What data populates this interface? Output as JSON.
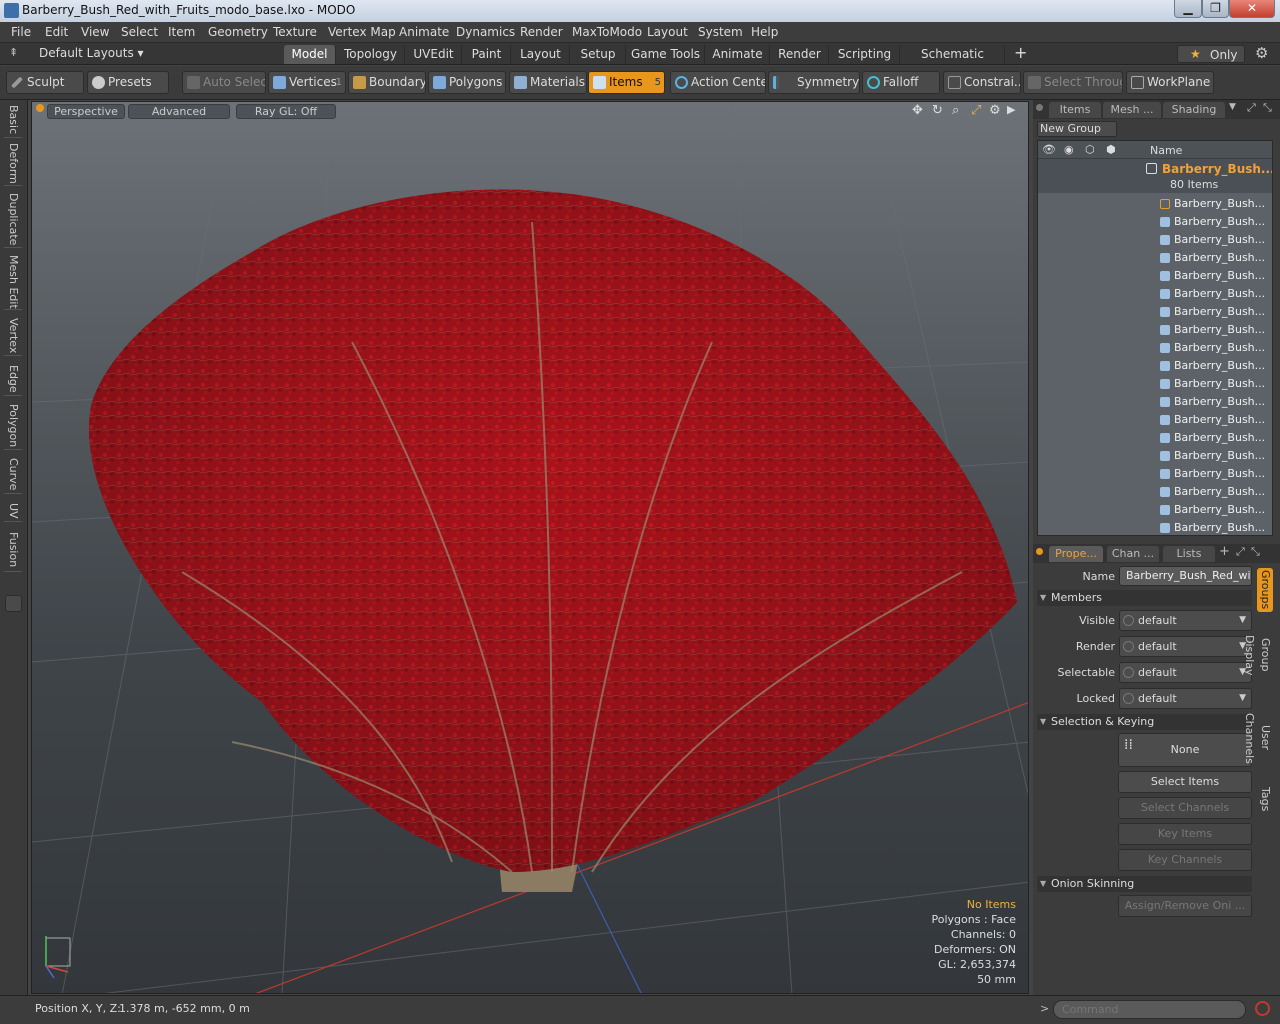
{
  "window": {
    "title": "Barberry_Bush_Red_with_Fruits_modo_base.lxo - MODO",
    "min": "▁",
    "max": "❐",
    "close": "✕"
  },
  "menu": [
    "File",
    "Edit",
    "View",
    "Select",
    "Item",
    "Geometry",
    "Texture",
    "Vertex Map",
    "Animate",
    "Dynamics",
    "Render",
    "MaxToModo",
    "Layout",
    "System",
    "Help"
  ],
  "layoutbar": {
    "layouts_dropdown": "Default Layouts ▾",
    "tabs": [
      "Model",
      "Topology",
      "UVEdit",
      "Paint",
      "Layout",
      "Setup",
      "Game Tools",
      "Animate",
      "Render",
      "Scripting",
      "Schematic Fusion"
    ],
    "active_tab": "Model",
    "add": "+",
    "only_label": "Only",
    "star": "★",
    "gear": "⚙"
  },
  "toolbar": {
    "sculpt": "Sculpt",
    "presets": "Presets",
    "auto_select": "Auto Select",
    "vertices": "Vertices",
    "vertices_count": "1",
    "boundary": "Boundary",
    "polygons": "Polygons",
    "materials": "Materials",
    "items": "Items",
    "items_count": "5",
    "action_center": "Action Center",
    "symmetry": "Symmetry",
    "falloff": "Falloff",
    "constraints": "Constrai...",
    "select_through": "Select Through",
    "workplane": "WorkPlane"
  },
  "left_tabs": [
    "Basic",
    "Deform",
    "Duplicate",
    "Mesh Edit",
    "Vertex",
    "Edge",
    "Polygon",
    "Curve",
    "UV",
    "Fusion"
  ],
  "viewport": {
    "perspective": "Perspective",
    "advanced": "Advanced",
    "raygl": "Ray GL: Off",
    "info": {
      "no_items": "No Items",
      "polygons": "Polygons : Face",
      "channels": "Channels: 0",
      "deformers": "Deformers: ON",
      "gl": "GL: 2,653,374",
      "scale": "50 mm"
    }
  },
  "items_panel": {
    "tabs": [
      "Items",
      "Mesh ...",
      "Shading"
    ],
    "new_group": "New Group",
    "name_header": "Name",
    "group_name": "Barberry_Bush...",
    "group_count": "80 Items",
    "children": [
      "Barberry_Bush...",
      "Barberry_Bush...",
      "Barberry_Bush...",
      "Barberry_Bush...",
      "Barberry_Bush...",
      "Barberry_Bush...",
      "Barberry_Bush...",
      "Barberry_Bush...",
      "Barberry_Bush...",
      "Barberry_Bush...",
      "Barberry_Bush...",
      "Barberry_Bush...",
      "Barberry_Bush...",
      "Barberry_Bush...",
      "Barberry_Bush...",
      "Barberry_Bush...",
      "Barberry_Bush...",
      "Barberry_Bush...",
      "Barberry_Bush..."
    ]
  },
  "properties_panel": {
    "tabs": [
      "Prope...",
      "Chan ...",
      "Lists"
    ],
    "add": "+",
    "name_label": "Name",
    "name_value": "Barberry_Bush_Red_with",
    "members_section": "Members",
    "visible_label": "Visible",
    "visible_value": "default",
    "render_label": "Render",
    "render_value": "default",
    "selectable_label": "Selectable",
    "selectable_value": "default",
    "locked_label": "Locked",
    "locked_value": "default",
    "selection_section": "Selection & Keying",
    "none_label": "None",
    "select_items": "Select Items",
    "select_channels": "Select Channels",
    "key_items": "Key Items",
    "key_channels": "Key Channels",
    "onion_section": "Onion Skinning",
    "assign_remove": "Assign/Remove Oni ...",
    "side_tabs": [
      "Groups",
      "Group Display",
      "User Channels",
      "Tags"
    ]
  },
  "statusbar": {
    "position_label": "Position X, Y, Z:",
    "position_value": "1.378 m, -652 mm, 0 m",
    "command_placeholder": "Command",
    "prompt": ">"
  },
  "colors": {
    "accent": "#e8961c",
    "foliage": "#a8121a",
    "item_highlight": "#f0a23a"
  }
}
